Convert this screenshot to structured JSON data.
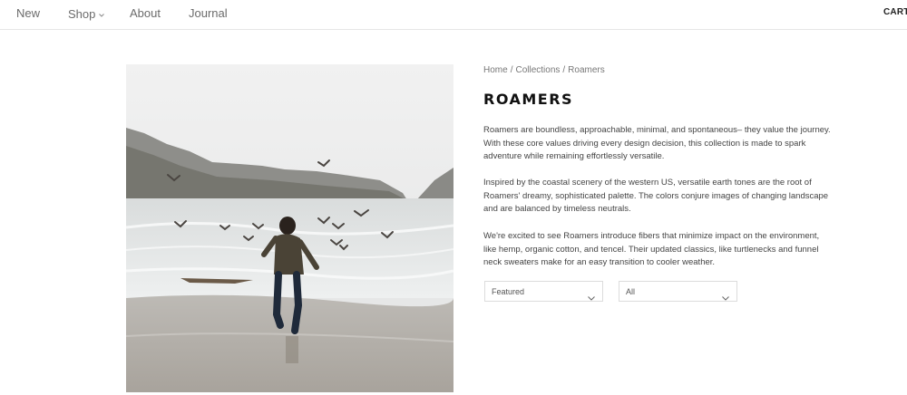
{
  "nav": {
    "items": [
      {
        "label": "New"
      },
      {
        "label": "Shop"
      },
      {
        "label": "About"
      },
      {
        "label": "Journal"
      }
    ],
    "cart_label": "CART (",
    "shop_icon": "chevron-down-icon"
  },
  "breadcrumb": {
    "items": [
      "Home",
      "Collections",
      "Roamers"
    ],
    "separator": "/"
  },
  "collection": {
    "title": "ROAMERS",
    "paragraphs": [
      "Roamers are boundless, approachable, minimal, and spontaneous– they value the journey. With these core values driving every design decision, this collection is made to spark adventure while remaining effortlessly versatile.",
      "Inspired by the coastal scenery of the western US, versatile earth tones are the root of Roamers' dreamy, sophisticated palette. The colors conjure images of changing landscape and are balanced by timeless neutrals.",
      "We're excited to see Roamers introduce fibers that minimize impact on the environment, like hemp, organic cotton, and tencel. Their updated classics, like turtlenecks and funnel neck sweaters make for an easy transition to cooler weather."
    ]
  },
  "filters": {
    "sort": {
      "value": "Featured",
      "icon": "chevron-down-icon"
    },
    "type": {
      "value": "All",
      "icon": "chevron-down-icon"
    }
  },
  "colors": {
    "nav_text": "#6b6b6b",
    "body_text": "#444444",
    "title": "#111111",
    "border": "#dcdcdc"
  }
}
